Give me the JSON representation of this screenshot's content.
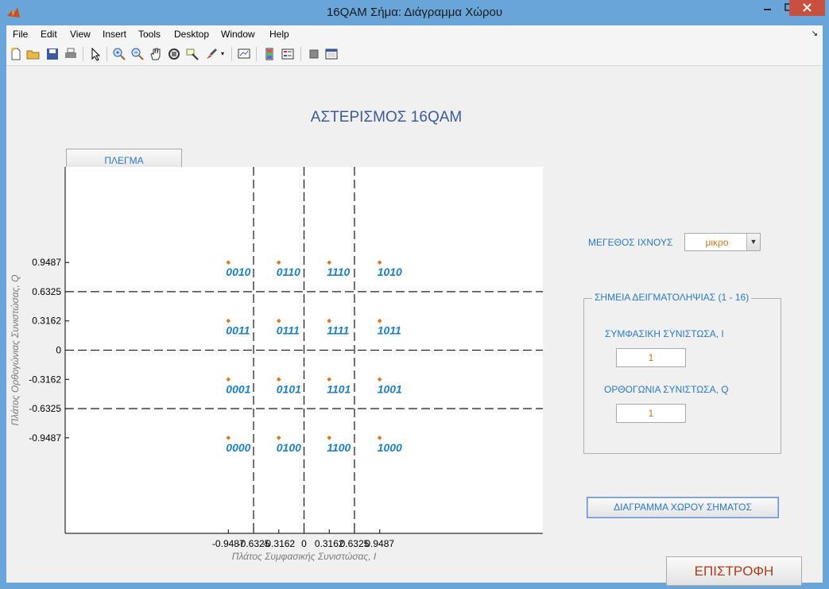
{
  "window": {
    "title": "16QAM Σήμα: Διάγραμμα Χώρου"
  },
  "menu": [
    "File",
    "Edit",
    "View",
    "Insert",
    "Tools",
    "Desktop",
    "Window",
    "Help"
  ],
  "figure": {
    "title": "ΑΣΤΕΡΙΣΜΟΣ 16QAM",
    "grid_button": "ΠΛΕΓΜΑ",
    "trace_size_label": "ΜΕΓΕΘΟΣ ΙΧΝΟΥΣ",
    "trace_size_value": "μικρο",
    "panel_title": "ΣΗΜΕΙΑ ΔΕΙΓΜΑΤΟΛΗΨΙΑΣ (1 - 16)",
    "inphase_label": "ΣΥΜΦΑΣΙΚΗ ΣΥΝΙΣΤΩΣΑ, I",
    "inphase_value": "1",
    "quadrature_label": "ΟΡΘΟΓΩΝΙΑ ΣΥΝΙΣΤΩΣΑ, Q",
    "quadrature_value": "1",
    "diagram_button": "ΔΙΑΓΡΑΜΜΑ ΧΩΡΟΥ ΣΗΜΑΤΟΣ",
    "back_button": "ΕΠΙΣΤΡΟΦΗ"
  },
  "chart_data": {
    "type": "scatter",
    "xlabel": "Πλάτος Συμφασικής Συνιστώσας, I",
    "ylabel": "Πλάτος Ορθογώνιας Συνιστώσας, Q",
    "xlim": [
      -1.58,
      1.58
    ],
    "ylim": [
      -1.21,
      1.21
    ],
    "xticks": [
      -0.9487,
      -0.6325,
      -0.3162,
      0,
      0.3162,
      0.6325,
      0.9487
    ],
    "xtick_labels": [
      "-0.9487",
      "-0.6325",
      "-0.3162",
      "0",
      "0.3162",
      "0.6325",
      "0.9487"
    ],
    "yticks": [
      0.9487,
      0.6325,
      0.3162,
      0,
      -0.3162,
      -0.6325,
      -0.9487
    ],
    "ytick_labels": [
      "0.9487",
      "0.6325",
      "0.3162",
      "0",
      "-0.3162",
      "-0.6325",
      "-0.9487"
    ],
    "grid_lines_x": [
      -0.6325,
      0,
      0.6325
    ],
    "grid_lines_y": [
      0.6325,
      0,
      -0.6325
    ],
    "point_color": "#d97a1a",
    "label_color": "#1f7fc1",
    "points": [
      {
        "i": -0.9487,
        "q": 0.9487,
        "label": "0010"
      },
      {
        "i": -0.3162,
        "q": 0.9487,
        "label": "0110"
      },
      {
        "i": 0.3162,
        "q": 0.9487,
        "label": "1110"
      },
      {
        "i": 0.9487,
        "q": 0.9487,
        "label": "1010"
      },
      {
        "i": -0.9487,
        "q": 0.3162,
        "label": "0011"
      },
      {
        "i": -0.3162,
        "q": 0.3162,
        "label": "0111"
      },
      {
        "i": 0.3162,
        "q": 0.3162,
        "label": "1111"
      },
      {
        "i": 0.9487,
        "q": 0.3162,
        "label": "1011"
      },
      {
        "i": -0.9487,
        "q": -0.3162,
        "label": "0001"
      },
      {
        "i": -0.3162,
        "q": -0.3162,
        "label": "0101"
      },
      {
        "i": 0.3162,
        "q": -0.3162,
        "label": "1101"
      },
      {
        "i": 0.9487,
        "q": -0.3162,
        "label": "1001"
      },
      {
        "i": -0.9487,
        "q": -0.9487,
        "label": "0000"
      },
      {
        "i": -0.3162,
        "q": -0.9487,
        "label": "0100"
      },
      {
        "i": 0.3162,
        "q": -0.9487,
        "label": "1100"
      },
      {
        "i": 0.9487,
        "q": -0.9487,
        "label": "1000"
      }
    ]
  }
}
